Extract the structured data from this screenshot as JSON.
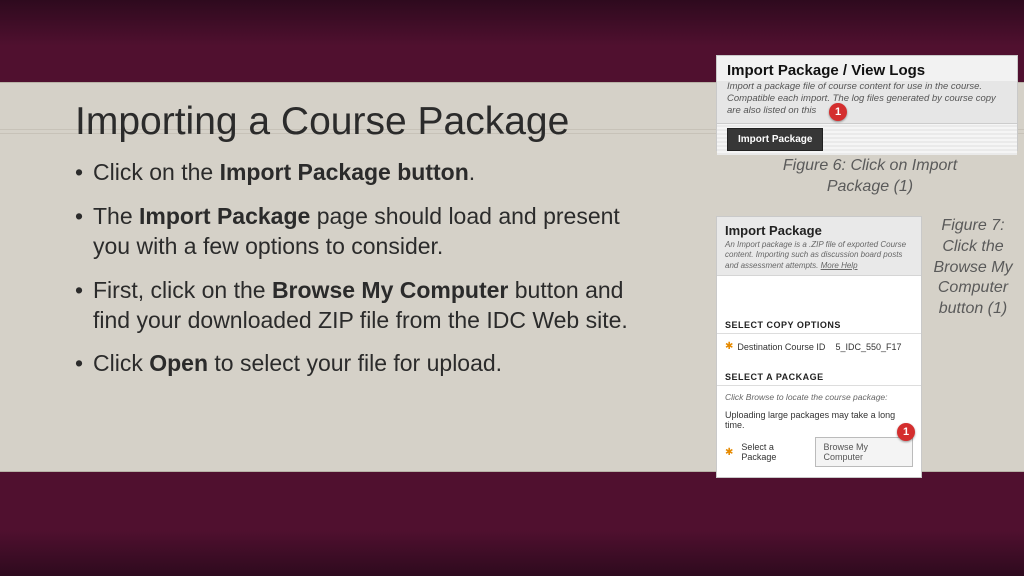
{
  "title": "Importing a Course Package",
  "bullets": {
    "b1_pre": "Click on the ",
    "b1_bold": "Import Package button",
    "b1_post": ".",
    "b2_pre": "The ",
    "b2_bold": "Import Package",
    "b2_post": " page should load and present you with a few options to consider.",
    "b3_pre": "First, click on the ",
    "b3_bold": "Browse My Computer",
    "b3_post": " button and find your downloaded ZIP file from the IDC Web site.",
    "b4_pre": "Click ",
    "b4_bold": "Open",
    "b4_post": " to select your file for upload."
  },
  "fig6": {
    "title": "Import Package / View Logs",
    "desc": "Import a package file of course content for use in the course. Compatible each import. The log files generated by course copy are also listed on this",
    "button": "Import Package",
    "badge": "1",
    "caption": "Figure 6: Click on Import Package (1)"
  },
  "fig7": {
    "title": "Import Package",
    "sub": "An Import package is a .ZIP file of exported Course content. Importing such as discussion board posts and assessment attempts.",
    "more": "More Help",
    "sec1": "SELECT COPY OPTIONS",
    "dest_label": "Destination Course ID",
    "dest_value": "5_IDC_550_F17",
    "sec2": "SELECT A PACKAGE",
    "note": "Click Browse to locate the course package:",
    "warn": "Uploading large packages may take a long time.",
    "pkg_label": "Select a Package",
    "browse": "Browse My Computer",
    "badge": "1",
    "caption": "Figure 7: Click the Browse My Computer button (1)"
  }
}
